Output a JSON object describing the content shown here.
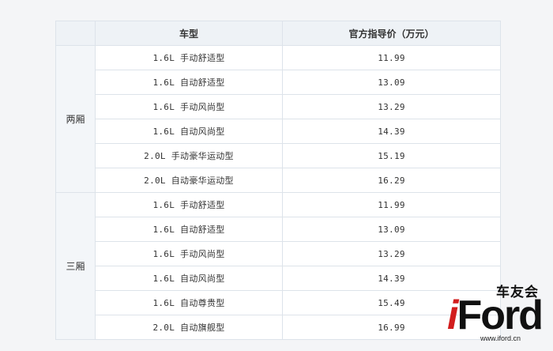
{
  "table": {
    "headers": {
      "group": "",
      "model": "车型",
      "price": "官方指导价（万元）"
    },
    "groups": [
      {
        "name": "两厢",
        "rows": [
          {
            "model": "1.6L 手动舒适型",
            "price": "11.99"
          },
          {
            "model": "1.6L 自动舒适型",
            "price": "13.09"
          },
          {
            "model": "1.6L 手动风尚型",
            "price": "13.29"
          },
          {
            "model": "1.6L 自动风尚型",
            "price": "14.39"
          },
          {
            "model": "2.0L 手动豪华运动型",
            "price": "15.19"
          },
          {
            "model": "2.0L 自动豪华运动型",
            "price": "16.29"
          }
        ]
      },
      {
        "name": "三厢",
        "rows": [
          {
            "model": "1.6L 手动舒适型",
            "price": "11.99"
          },
          {
            "model": "1.6L 自动舒适型",
            "price": "13.09"
          },
          {
            "model": "1.6L 手动风尚型",
            "price": "13.29"
          },
          {
            "model": "1.6L 自动风尚型",
            "price": "14.39"
          },
          {
            "model": "1.6L 自动尊贵型",
            "price": "15.49"
          },
          {
            "model": "2.0L 自动旗舰型",
            "price": "16.99"
          }
        ]
      }
    ]
  },
  "watermark": {
    "tagline": "车友会",
    "brand_i": "i",
    "brand_rest": "Ford",
    "url": "www.iford.cn",
    "accent": "#d21d1d"
  }
}
